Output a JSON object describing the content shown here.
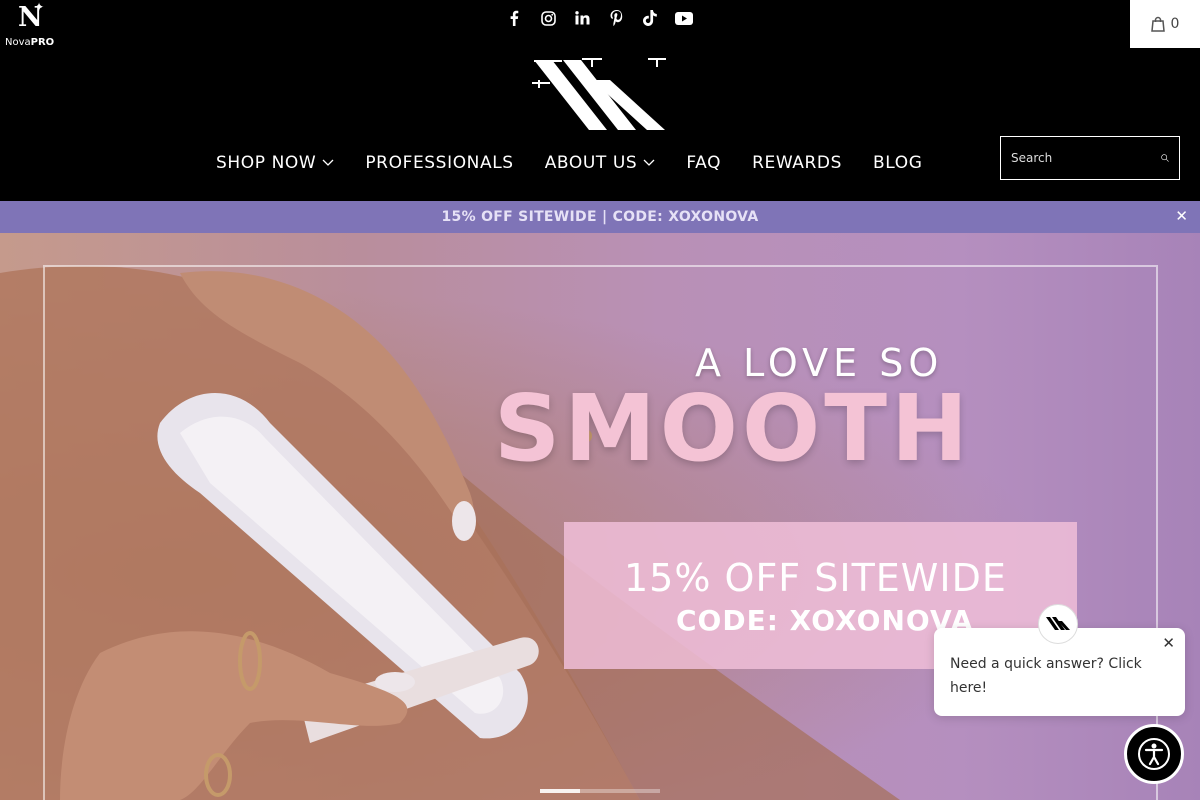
{
  "brand": {
    "nova_letter": "N",
    "nova_text_regular": "Nova",
    "nova_text_bold": "PRO"
  },
  "socials": [
    {
      "icon": "facebook-icon"
    },
    {
      "icon": "instagram-icon"
    },
    {
      "icon": "linkedin-icon"
    },
    {
      "icon": "pinterest-icon"
    },
    {
      "icon": "tiktok-icon"
    },
    {
      "icon": "youtube-icon"
    }
  ],
  "cart": {
    "count": "0",
    "icon": "bag-icon"
  },
  "nav": {
    "items": [
      {
        "label": "SHOP NOW",
        "has_dropdown": true
      },
      {
        "label": "PROFESSIONALS",
        "has_dropdown": false
      },
      {
        "label": "ABOUT US",
        "has_dropdown": true
      },
      {
        "label": "FAQ",
        "has_dropdown": false
      },
      {
        "label": "REWARDS",
        "has_dropdown": false
      },
      {
        "label": "BLOG",
        "has_dropdown": false
      }
    ]
  },
  "search": {
    "placeholder": "Search",
    "value": ""
  },
  "promo": {
    "text": "15% OFF SITEWIDE | CODE: XOXONOVA",
    "background": "#7f74b7",
    "close_glyph": "✕"
  },
  "hero": {
    "headline_small": "A LOVE SO",
    "headline_large": "SMOOTH",
    "offer": "15% OFF SITEWIDE",
    "code": "CODE: XOXONOVA",
    "slide_count": 3,
    "active_slide": 1,
    "accent": "#f4c3d5"
  },
  "chat": {
    "message": "Need a quick answer? Click here!",
    "close_glyph": "✕"
  }
}
